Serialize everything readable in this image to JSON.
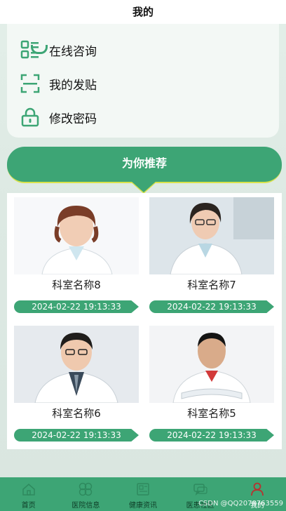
{
  "header": {
    "title": "我的"
  },
  "menu": {
    "items": [
      {
        "label": "在线咨询",
        "icon": "list-icon"
      },
      {
        "label": "我的发贴",
        "icon": "scan-frame-icon"
      },
      {
        "label": "修改密码",
        "icon": "lock-icon"
      }
    ]
  },
  "recommend": {
    "title": "为你推荐"
  },
  "doctors": [
    {
      "name": "科室名称8",
      "date": "2024-02-22 19:13:33"
    },
    {
      "name": "科室名称7",
      "date": "2024-02-22 19:13:33"
    },
    {
      "name": "科室名称6",
      "date": "2024-02-22 19:13:33"
    },
    {
      "name": "科室名称5",
      "date": "2024-02-22 19:13:33"
    }
  ],
  "nav": {
    "items": [
      {
        "label": "首页",
        "icon": "home-icon"
      },
      {
        "label": "医院信息",
        "icon": "clover-icon"
      },
      {
        "label": "健康资讯",
        "icon": "news-icon"
      },
      {
        "label": "医患社区",
        "icon": "chat-icon"
      },
      {
        "label": "我的",
        "icon": "user-icon",
        "active": true
      }
    ]
  },
  "watermark": "CSDN @QQ2078763559",
  "colors": {
    "accent": "#3da575",
    "highlight": "#d8e24a"
  }
}
